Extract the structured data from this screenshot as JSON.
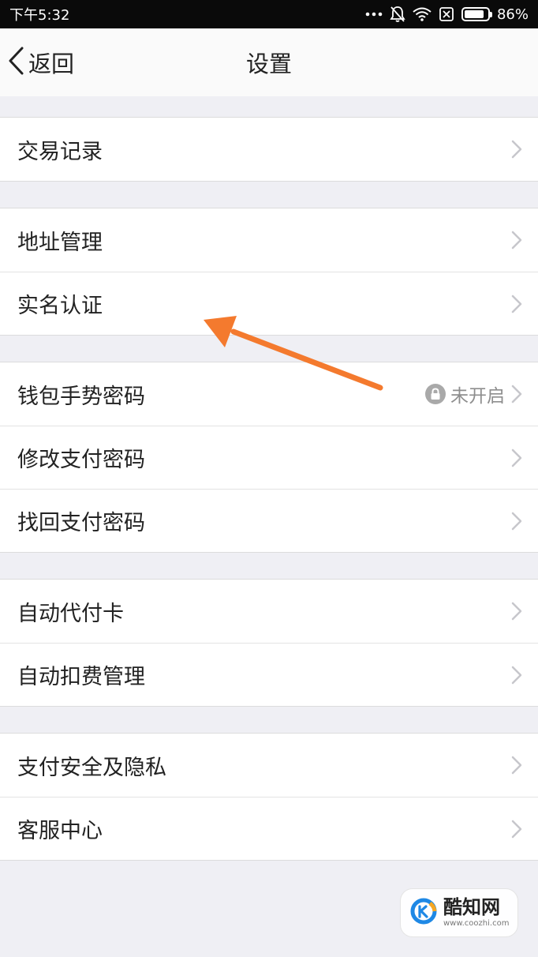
{
  "status_bar": {
    "time": "下午5:32",
    "battery": "86%",
    "battery_level": 0.86,
    "icons": [
      "dots-icon",
      "bell-muted-icon",
      "wifi-icon",
      "sim-off-icon",
      "battery-icon"
    ]
  },
  "nav": {
    "back_label": "返回",
    "title": "设置"
  },
  "groups": [
    {
      "items": [
        {
          "label": "交易记录"
        }
      ]
    },
    {
      "items": [
        {
          "label": "地址管理"
        },
        {
          "label": "实名认证"
        }
      ]
    },
    {
      "items": [
        {
          "label": "钱包手势密码",
          "status": "未开启",
          "status_icon": "lock-icon"
        },
        {
          "label": "修改支付密码"
        },
        {
          "label": "找回支付密码"
        }
      ]
    },
    {
      "items": [
        {
          "label": "自动代付卡"
        },
        {
          "label": "自动扣费管理"
        }
      ]
    },
    {
      "items": [
        {
          "label": "支付安全及隐私"
        },
        {
          "label": "客服中心"
        }
      ]
    }
  ],
  "annotation": {
    "type": "arrow",
    "color": "#f47a2e",
    "points_to": "实名认证"
  },
  "watermark": {
    "name": "酷知网",
    "url": "www.coozhi.com",
    "colors": {
      "blue": "#1e88e5",
      "orange": "#f5a623"
    }
  },
  "colors": {
    "background": "#efeff4",
    "status_bar": "#0a0a0a",
    "nav_bar": "#fafafa",
    "text": "#222222",
    "secondary_text": "#8e8e8e",
    "chevron": "#c7c7cc"
  }
}
